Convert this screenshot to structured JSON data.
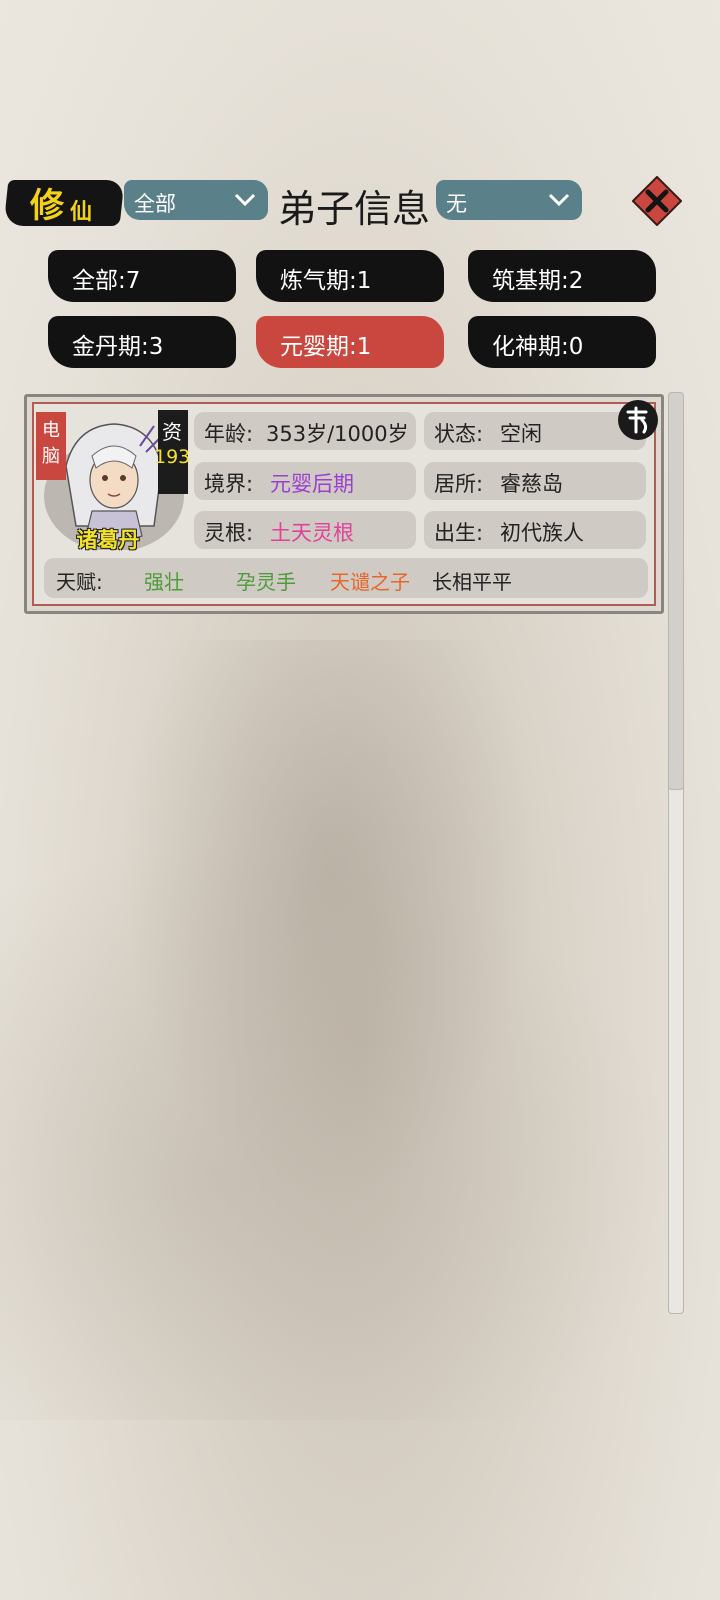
{
  "header": {
    "logo_big": "修",
    "logo_small": "仙",
    "filter_left": "全部",
    "title": "弟子信息",
    "filter_right": "无"
  },
  "tabs": [
    {
      "label": "全部:7",
      "active": false
    },
    {
      "label": "炼气期:1",
      "active": false
    },
    {
      "label": "筑基期:2",
      "active": false
    },
    {
      "label": "金丹期:3",
      "active": false
    },
    {
      "label": "元婴期:1",
      "active": true
    },
    {
      "label": "化神期:0",
      "active": false
    }
  ],
  "disciple": {
    "control_tag": "电脑",
    "aptitude_label": "资",
    "aptitude_value": "193",
    "name": "诸葛丹",
    "age_label": "年龄:",
    "age_value": "353岁/1000岁",
    "status_label": "状态:",
    "status_value": "空闲",
    "realm_label": "境界:",
    "realm_value": "元婴后期",
    "residence_label": "居所:",
    "residence_value": "睿慈岛",
    "root_label": "灵根:",
    "root_value": "土天灵根",
    "birth_label": "出生:",
    "birth_value": "初代族人",
    "mount_icon": "mount-badge",
    "talent_label": "天赋:",
    "talents": [
      {
        "text": "强壮",
        "color": "#4f9a3a"
      },
      {
        "text": "孕灵手",
        "color": "#4f9a3a"
      },
      {
        "text": "天谴之子",
        "color": "#e8652a"
      },
      {
        "text": "长相平平",
        "color": "#222222"
      }
    ]
  },
  "colors": {
    "realm": "#9b3fd0",
    "root": "#e0429a",
    "active_tab": "#c9473e",
    "accent_yellow": "#f3e22c"
  }
}
